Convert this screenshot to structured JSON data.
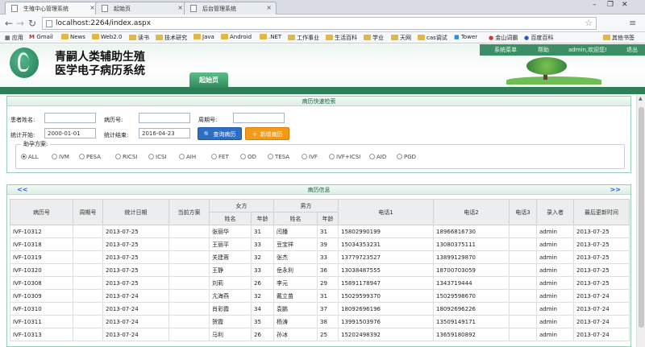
{
  "browser": {
    "tabs": [
      {
        "title": "生殖中心管理系统"
      },
      {
        "title": "起始页"
      },
      {
        "title": "后台管理系统"
      }
    ],
    "url": "localhost:2264/index.aspx",
    "bookmarks": [
      "应用",
      "Gmail",
      "News",
      "Web2.0",
      "读书",
      "技术研究",
      "Java",
      "Android",
      ".NET",
      "工作事业",
      "生活百科",
      "学业",
      "天网",
      "cas调试",
      "Tower",
      "金山词霸",
      "百度百科",
      "其他书签"
    ]
  },
  "header": {
    "title_line1": "青嗣人类辅助生殖",
    "title_line2": "医学电子病历系统",
    "menu": [
      "系统菜单",
      "帮助",
      "admin,欢迎您!",
      "退出"
    ],
    "start_tab": "起始页"
  },
  "search": {
    "title": "病历快速检索",
    "patient_name_label": "患者姓名:",
    "record_no_label": "病历号:",
    "cycle_no_label": "周期号:",
    "start_label": "统计开始:",
    "start_value": "2000-01-01",
    "end_label": "统计结束:",
    "end_value": "2016-04-23",
    "query_button": "查询病历",
    "new_button": "新增病历",
    "scheme_label": "助孕方案:",
    "schemes": [
      "ALL",
      "IVM",
      "PESA",
      "RICSI",
      "ICSI",
      "AIH",
      "FET",
      "OD",
      "TESA",
      "IVF",
      "IVF+ICSI",
      "AID",
      "PGD"
    ],
    "selected_scheme": "ALL"
  },
  "records": {
    "title": "病历信息",
    "prev": "<<",
    "next": ">>",
    "headers": {
      "record_no": "病历号",
      "cycle_no": "周期号",
      "date": "统计日期",
      "scheme": "当前方案",
      "female": "女方",
      "male": "男方",
      "name": "姓名",
      "age": "年龄",
      "phone1": "电话1",
      "phone2": "电话2",
      "phone3": "电话3",
      "entered_by": "录入者",
      "updated": "最后更新时间"
    },
    "rows": [
      {
        "no": "IVF-10312",
        "cycle": "",
        "date": "2013-07-25",
        "scheme": "",
        "fname": "张丽华",
        "fage": "31",
        "mname": "闫播",
        "mage": "31",
        "p1": "15802990199",
        "p2": "18966816730",
        "p3": "",
        "by": "admin",
        "upd": "2013-07-25"
      },
      {
        "no": "IVF-10318",
        "cycle": "",
        "date": "2013-07-25",
        "scheme": "",
        "fname": "王丽平",
        "fage": "33",
        "mname": "豆宝祥",
        "mage": "39",
        "p1": "15034353231",
        "p2": "13080375111",
        "p3": "",
        "by": "admin",
        "upd": "2013-07-25"
      },
      {
        "no": "IVF-10319",
        "cycle": "",
        "date": "2013-07-25",
        "scheme": "",
        "fname": "关建蓉",
        "fage": "32",
        "mname": "张杰",
        "mage": "33",
        "p1": "13779723527",
        "p2": "13899129870",
        "p3": "",
        "by": "admin",
        "upd": "2013-07-25"
      },
      {
        "no": "IVF-10320",
        "cycle": "",
        "date": "2013-07-25",
        "scheme": "",
        "fname": "王静",
        "fage": "33",
        "mname": "岳永利",
        "mage": "36",
        "p1": "13038487555",
        "p2": "18700703059",
        "p3": "",
        "by": "admin",
        "upd": "2013-07-25"
      },
      {
        "no": "IVF-10308",
        "cycle": "",
        "date": "2013-07-25",
        "scheme": "",
        "fname": "刘莉",
        "fage": "26",
        "mname": "李元",
        "mage": "29",
        "p1": "15891178947",
        "p2": "1343719444",
        "p3": "",
        "by": "admin",
        "upd": "2013-07-25"
      },
      {
        "no": "IVF-10309",
        "cycle": "",
        "date": "2013-07-24",
        "scheme": "",
        "fname": "亢海燕",
        "fage": "32",
        "mname": "戴立苗",
        "mage": "31",
        "p1": "15029599370",
        "p2": "15029598670",
        "p3": "",
        "by": "admin",
        "upd": "2013-07-24"
      },
      {
        "no": "IVF-10310",
        "cycle": "",
        "date": "2013-07-24",
        "scheme": "",
        "fname": "肖彩霞",
        "fage": "34",
        "mname": "袁鹏",
        "mage": "37",
        "p1": "18092696196",
        "p2": "18092696226",
        "p3": "",
        "by": "admin",
        "upd": "2013-07-24"
      },
      {
        "no": "IVF-10311",
        "cycle": "",
        "date": "2013-07-24",
        "scheme": "",
        "fname": "贺霞",
        "fage": "35",
        "mname": "杨涛",
        "mage": "38",
        "p1": "13991503976",
        "p2": "13509149171",
        "p3": "",
        "by": "admin",
        "upd": "2013-07-24"
      },
      {
        "no": "IVF-10313",
        "cycle": "",
        "date": "2013-07-24",
        "scheme": "",
        "fname": "马利",
        "fage": "26",
        "mname": "孙冰",
        "mage": "25",
        "p1": "15202498392",
        "p2": "13659180892",
        "p3": "",
        "by": "admin",
        "upd": "2013-07-24"
      }
    ]
  },
  "colors": {
    "accent_green": "#2f7f58",
    "query_blue": "#2c6fc4",
    "new_orange": "#f39a1a"
  }
}
